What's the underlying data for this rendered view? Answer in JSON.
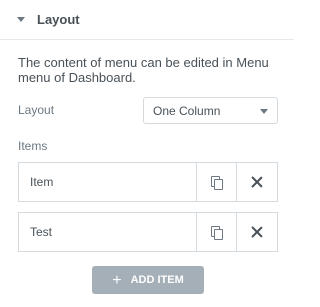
{
  "section": {
    "title": "Layout"
  },
  "description": "The content of menu can be edited in Menu menu of Dashboard.",
  "layout_field": {
    "label": "Layout",
    "selected": "One Column"
  },
  "items_field": {
    "label": "Items",
    "rows": [
      {
        "title": "Item"
      },
      {
        "title": "Test"
      }
    ]
  },
  "add_button": {
    "icon": "+",
    "label": "ADD ITEM"
  }
}
